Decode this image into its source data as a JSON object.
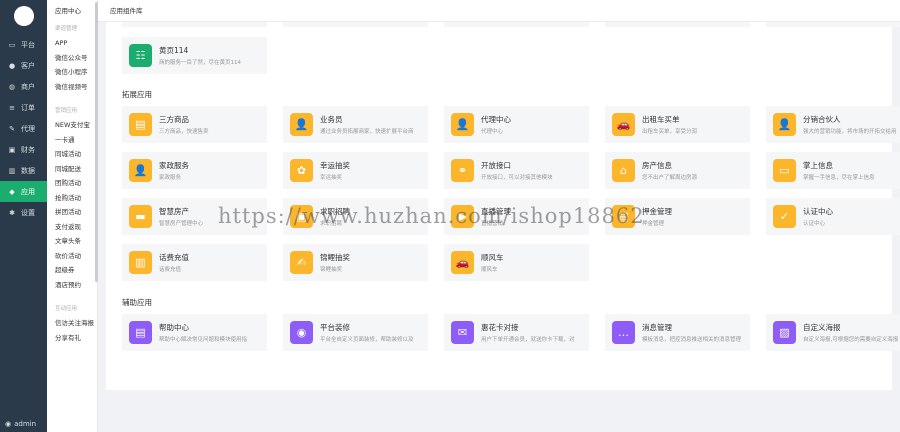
{
  "sidebar": {
    "items": [
      {
        "icon": "monitor-icon",
        "glyph": "▭",
        "label": "平台"
      },
      {
        "icon": "user-icon",
        "glyph": "●",
        "label": "客户"
      },
      {
        "icon": "users-icon",
        "glyph": "◍",
        "label": "商户"
      },
      {
        "icon": "list-icon",
        "glyph": "≡",
        "label": "订单"
      },
      {
        "icon": "edit-icon",
        "glyph": "✎",
        "label": "代理"
      },
      {
        "icon": "finance-icon",
        "glyph": "▣",
        "label": "财务"
      },
      {
        "icon": "chart-icon",
        "glyph": "▥",
        "label": "数据"
      },
      {
        "icon": "app-icon",
        "glyph": "◆",
        "label": "应用",
        "active": true
      },
      {
        "icon": "gear-icon",
        "glyph": "✱",
        "label": "设置"
      }
    ],
    "user": "admin"
  },
  "subnav": {
    "title": "应用中心",
    "group1": "渠道管理",
    "group1_items": [
      "APP",
      "微信公众号",
      "微信小程序",
      "微信视频号"
    ],
    "group2": "营销应用",
    "group2_items": [
      "NEW支付宝",
      "一卡通",
      "同城活动",
      "同城配送",
      "团购活动",
      "抢购活动",
      "拼团活动",
      "支付返现",
      "文章头条",
      "砍价活动",
      "超级券",
      "酒店预约"
    ],
    "group3": "互动应用",
    "group3_items": [
      "信访关注海报",
      "分享有礼"
    ]
  },
  "breadcrumb": "应用组件库",
  "top_card": {
    "icon": "yellowpages-icon",
    "glyph": "☷",
    "color": "#1aad6e",
    "title": "黄页114",
    "desc": "商的服务一目了然，尽在黄页114"
  },
  "sections": {
    "extend_title": "拓展应用",
    "assist_title": "辅助应用"
  },
  "extend_cards": [
    {
      "icon": "goods-icon",
      "glyph": "▤",
      "title": "三方商品",
      "desc": "三方商品，快速售卖"
    },
    {
      "icon": "salesman-icon",
      "glyph": "👤",
      "title": "业务员",
      "desc": "通过业务员拓展商家，快速扩展平台商"
    },
    {
      "icon": "agent-icon",
      "glyph": "👤",
      "title": "代理中心",
      "desc": "代理中心"
    },
    {
      "icon": "car-icon",
      "glyph": "🚗",
      "title": "出租车买单",
      "desc": "出租车买单，享受分润"
    },
    {
      "icon": "partner-icon",
      "glyph": "👤",
      "title": "分销合伙人",
      "desc": "强大的营销功能，将市场的开拓交给用"
    },
    {
      "icon": "housekeeping-icon",
      "glyph": "👤",
      "title": "家政服务",
      "desc": "家政服务"
    },
    {
      "icon": "lottery-icon",
      "glyph": "✿",
      "title": "幸运抽奖",
      "desc": "幸运抽奖"
    },
    {
      "icon": "api-icon",
      "glyph": "⚭",
      "title": "开放接口",
      "desc": "开放接口，可以对接其他模块"
    },
    {
      "icon": "house-icon",
      "glyph": "⌂",
      "title": "房产信息",
      "desc": "您不出户了解周边房源"
    },
    {
      "icon": "message-icon",
      "glyph": "▭",
      "title": "掌上信息",
      "desc": "掌握一手信息，尽在掌上信息"
    },
    {
      "icon": "realestate-icon",
      "glyph": "▬",
      "title": "智慧房产",
      "desc": "智慧房产管理中心"
    },
    {
      "icon": "job-icon",
      "glyph": "▣",
      "title": "求职招聘",
      "desc": "求职招聘"
    },
    {
      "icon": "live-icon",
      "glyph": "▶",
      "title": "直播管理",
      "desc": "直播营销"
    },
    {
      "icon": "deposit-icon",
      "glyph": "▤",
      "title": "押金管理",
      "desc": "押金管理"
    },
    {
      "icon": "shield-icon",
      "glyph": "✓",
      "title": "认证中心",
      "desc": "认证中心"
    },
    {
      "icon": "recharge-icon",
      "glyph": "▥",
      "title": "话费充值",
      "desc": "话费充值"
    },
    {
      "icon": "brocade-icon",
      "glyph": "✍",
      "title": "锦鲤抽奖",
      "desc": "锦鲤抽奖"
    },
    {
      "icon": "rideshare-icon",
      "glyph": "🚗",
      "title": "顺风车",
      "desc": "顺风车"
    }
  ],
  "assist_cards": [
    {
      "icon": "help-icon",
      "glyph": "▤",
      "title": "帮助中心",
      "desc": "帮助中心解决常见问题和模块使用指"
    },
    {
      "icon": "palette-icon",
      "glyph": "◉",
      "title": "平台装修",
      "desc": "平台全自定义页面装修，帮助装修以及"
    },
    {
      "icon": "flowercard-icon",
      "glyph": "✉",
      "title": "惠花卡对接",
      "desc": "用户下单开通会员，就送你卡下载，对"
    },
    {
      "icon": "chat-icon",
      "glyph": "…",
      "title": "消息管理",
      "desc": "模板消息，把控消息推送相关的消息管理"
    },
    {
      "icon": "poster-icon",
      "glyph": "▨",
      "title": "自定义海报",
      "desc": "自定义海报,可根据您的需要自定义海报"
    }
  ],
  "colors": {
    "extend": "#fbb62b",
    "assist": "#8e5cf7",
    "active": "#1aad6e"
  },
  "watermark": "https://www.huzhan.com/ishop18862"
}
